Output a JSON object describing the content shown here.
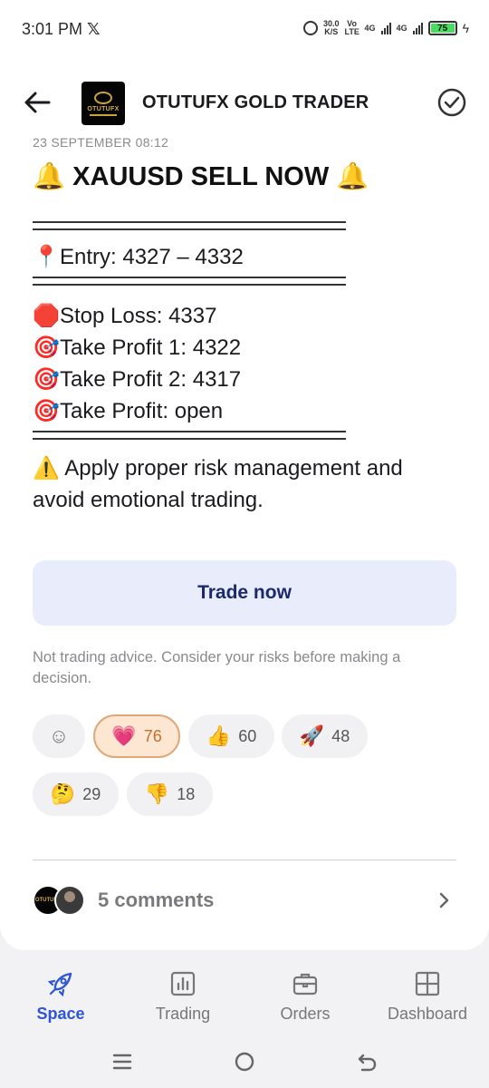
{
  "status_bar": {
    "time": "3:01 PM",
    "x_icon": "𝕏",
    "net_speed": "30.0",
    "net_unit": "K/S",
    "vo_lte": "Vo LTE",
    "net1": "4G",
    "net2": "4G",
    "battery": "75"
  },
  "header": {
    "channel_name": "OTUTUFX GOLD TRADER",
    "logo_text": "OTUTUFX"
  },
  "post": {
    "date": "23 SEPTEMBER 08:12",
    "title": "🔔 XAUUSD SELL NOW 🔔",
    "entry_emoji": "📍",
    "entry": "Entry: 4327 – 4332",
    "stop_emoji": "🛑",
    "stop_loss": "Stop Loss: 4337",
    "target_emoji": "🎯",
    "tp1": "Take Profit 1: 4322",
    "tp2": "Take Profit 2: 4317",
    "tp3": "Take Profit: open",
    "warning_emoji": "⚠️",
    "warning": "Apply proper risk management and avoid emotional trading."
  },
  "trade_button": "Trade now",
  "disclaimer": "Not trading advice. Consider your risks before making a decision.",
  "reactions": {
    "add_icon": "☺",
    "heart_icon": "💗",
    "heart_count": "76",
    "thumbs_up_icon": "👍",
    "thumbs_up_count": "60",
    "rocket_icon": "🚀",
    "rocket_count": "48",
    "thinking_icon": "🤔",
    "thinking_count": "29",
    "thumbs_down_icon": "👎",
    "thumbs_down_count": "18"
  },
  "comments": {
    "label": "5 comments",
    "avatar_text": "OTUTUFX"
  },
  "bottom_nav": {
    "items": [
      {
        "label": "Space",
        "icon": "rocket-icon"
      },
      {
        "label": "Trading",
        "icon": "chart-icon"
      },
      {
        "label": "Orders",
        "icon": "briefcase-icon"
      },
      {
        "label": "Dashboard",
        "icon": "grid-icon"
      }
    ]
  },
  "colors": {
    "accent": "#2d55d6",
    "trade_button_bg": "#e8ecfb",
    "trade_button_text": "#1a2a6c",
    "active_reaction_bg": "#fde7d2",
    "active_reaction_border": "#e0a878"
  }
}
